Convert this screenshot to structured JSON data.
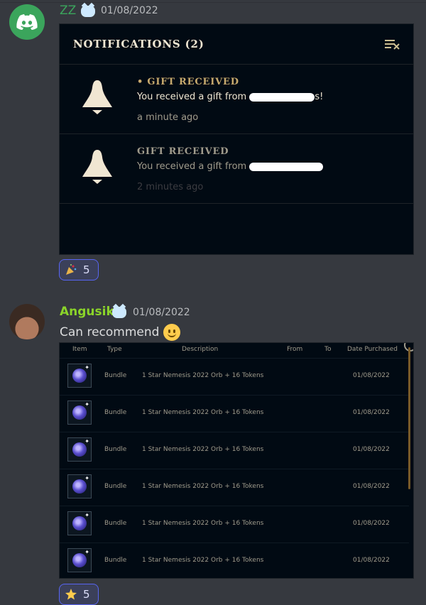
{
  "message1": {
    "username": "ZZ",
    "timestamp": "01/08/2022",
    "notifications": {
      "title": "NOTIFICATIONS (2)",
      "items": [
        {
          "heading": "• GIFT RECEIVED",
          "body_start": "You received a gift from ",
          "body_end": "s!",
          "time": "a minute ago",
          "unread": true
        },
        {
          "heading": "GIFT RECEIVED",
          "body_start": "You received a gift from ",
          "body_end": "",
          "time": "2 minutes ago",
          "unread": false
        }
      ]
    },
    "reaction": {
      "emoji": "party-popper",
      "count": "5"
    }
  },
  "message2": {
    "username": "Angusik",
    "timestamp": "01/08/2022",
    "text": "Can recommend",
    "table": {
      "headers": {
        "item": "Item",
        "type": "Type",
        "description": "Description",
        "from": "From",
        "to": "To",
        "date": "Date Purchased"
      },
      "rows": [
        {
          "type": "Bundle",
          "description": "1 Star Nemesis 2022 Orb + 16 Tokens",
          "date": "01/08/2022"
        },
        {
          "type": "Bundle",
          "description": "1 Star Nemesis 2022 Orb + 16 Tokens",
          "date": "01/08/2022"
        },
        {
          "type": "Bundle",
          "description": "1 Star Nemesis 2022 Orb + 16 Tokens",
          "date": "01/08/2022"
        },
        {
          "type": "Bundle",
          "description": "1 Star Nemesis 2022 Orb + 16 Tokens",
          "date": "01/08/2022"
        },
        {
          "type": "Bundle",
          "description": "1 Star Nemesis 2022 Orb + 16 Tokens",
          "date": "01/08/2022"
        },
        {
          "type": "Bundle",
          "description": "1 Star Nemesis 2022 Orb + 16 Tokens",
          "date": "01/08/2022"
        }
      ]
    },
    "reaction": {
      "emoji": "star",
      "count": "5"
    }
  },
  "colors": {
    "background": "#36393f",
    "notif_bg": "#010a13",
    "gold": "#c8aa6e",
    "username1": "#3ba55c",
    "username2": "#8bd42a",
    "reaction_border": "#5865f2"
  }
}
